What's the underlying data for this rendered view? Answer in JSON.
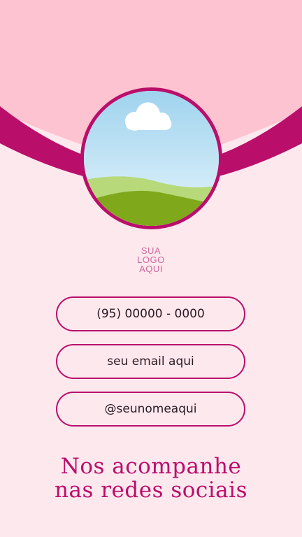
{
  "colors": {
    "top_panel": "#fec3d0",
    "arc": "#b90f6b",
    "background": "#fde8ee",
    "text_dark": "#2a1a22",
    "logo_text": "#cf6a9c"
  },
  "photo": {
    "icon": "landscape-placeholder"
  },
  "logo": {
    "line1": "SUA",
    "line2": "LOGO",
    "line3": "AQUI"
  },
  "contacts": {
    "phone": "(95) 00000 - 0000",
    "email": "seu email aqui",
    "social": "@seunomeaqui"
  },
  "tagline": {
    "line1": "Nos acompanhe",
    "line2": "nas redes sociais"
  }
}
